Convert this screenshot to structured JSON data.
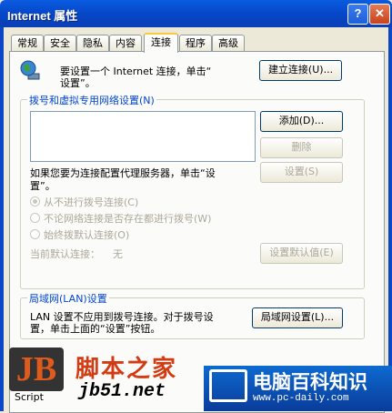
{
  "window": {
    "title": "Internet 属性",
    "help_glyph": "?",
    "close_glyph": "✕"
  },
  "tabs": [
    "常规",
    "安全",
    "隐私",
    "内容",
    "连接",
    "程序",
    "高级"
  ],
  "active_tab": "连接",
  "setup": {
    "text_line1": "要设置一个 Internet 连接，单击“",
    "text_line2": "设置”。",
    "button": "建立连接(U)..."
  },
  "dialup": {
    "group_label": "拨号和虚拟专用网络设置(N)",
    "add_button": "添加(D)...",
    "remove_button": "删除",
    "proxy_text_line1": "如果您要为连接配置代理服务器，单击“设",
    "proxy_text_line2": "置”。",
    "settings_button": "设置(S)",
    "options": [
      "从不进行拨号连接(C)",
      "不论网络连接是否存在都进行拨号(W)",
      "始终拨默认连接(O)"
    ],
    "current_default_label": "当前默认连接：",
    "current_default_value": "无",
    "set_default_button": "设置默认值(E)"
  },
  "lan": {
    "group_label": "局域网(LAN)设置",
    "text_line1": "LAN 设置不应用到拨号连接。对于拨号设",
    "text_line2": "置，单击上面的“设置”按钮。",
    "button": "局域网设置(L)..."
  },
  "watermarks": {
    "left_logo": "JB",
    "left_script": "Script",
    "left_title": "脚本之家",
    "left_site": "jb51.net",
    "right_title": "电脑百科知识",
    "right_site": "www.pc-daily.com"
  },
  "colors": {
    "titlebar": "#0a5ce0",
    "panel": "#fbfbf9",
    "group_label": "#0046d5",
    "watermark_red": "#d33b12",
    "watermark_blue": "#0d6ad0"
  }
}
